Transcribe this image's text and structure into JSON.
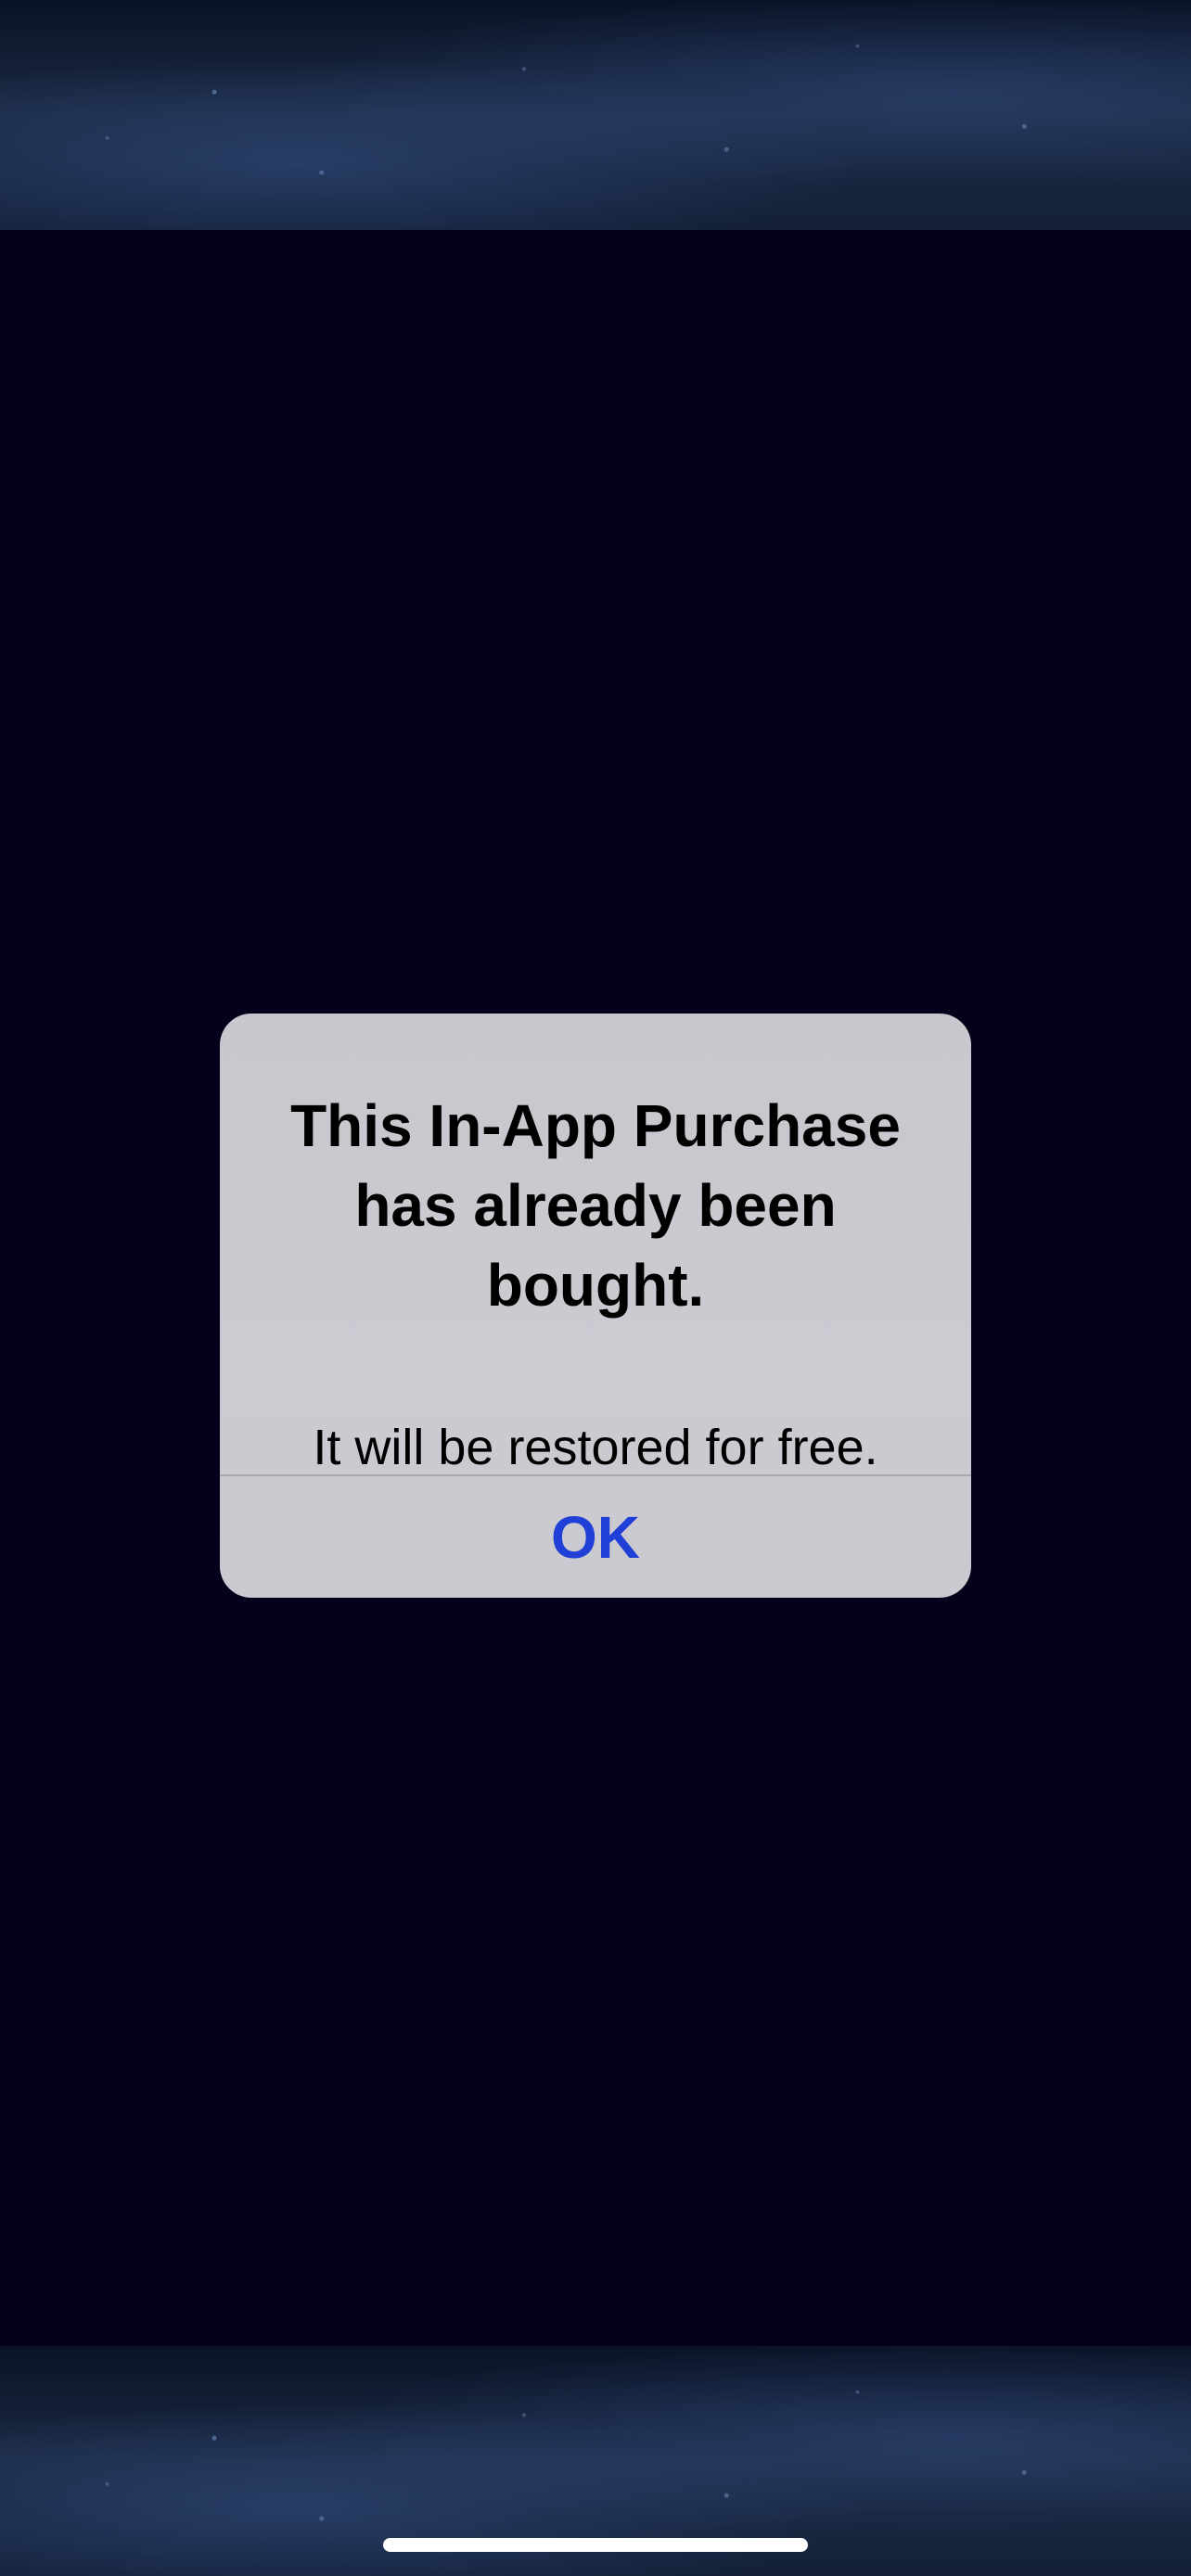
{
  "alert": {
    "title": "This In-App Purchase has already been bought.",
    "message": "It will be restored for free.",
    "ok_label": "OK"
  },
  "colors": {
    "background": "#03021a",
    "alert_background": "#c9c9cf",
    "button_text": "#1f3fd6"
  }
}
